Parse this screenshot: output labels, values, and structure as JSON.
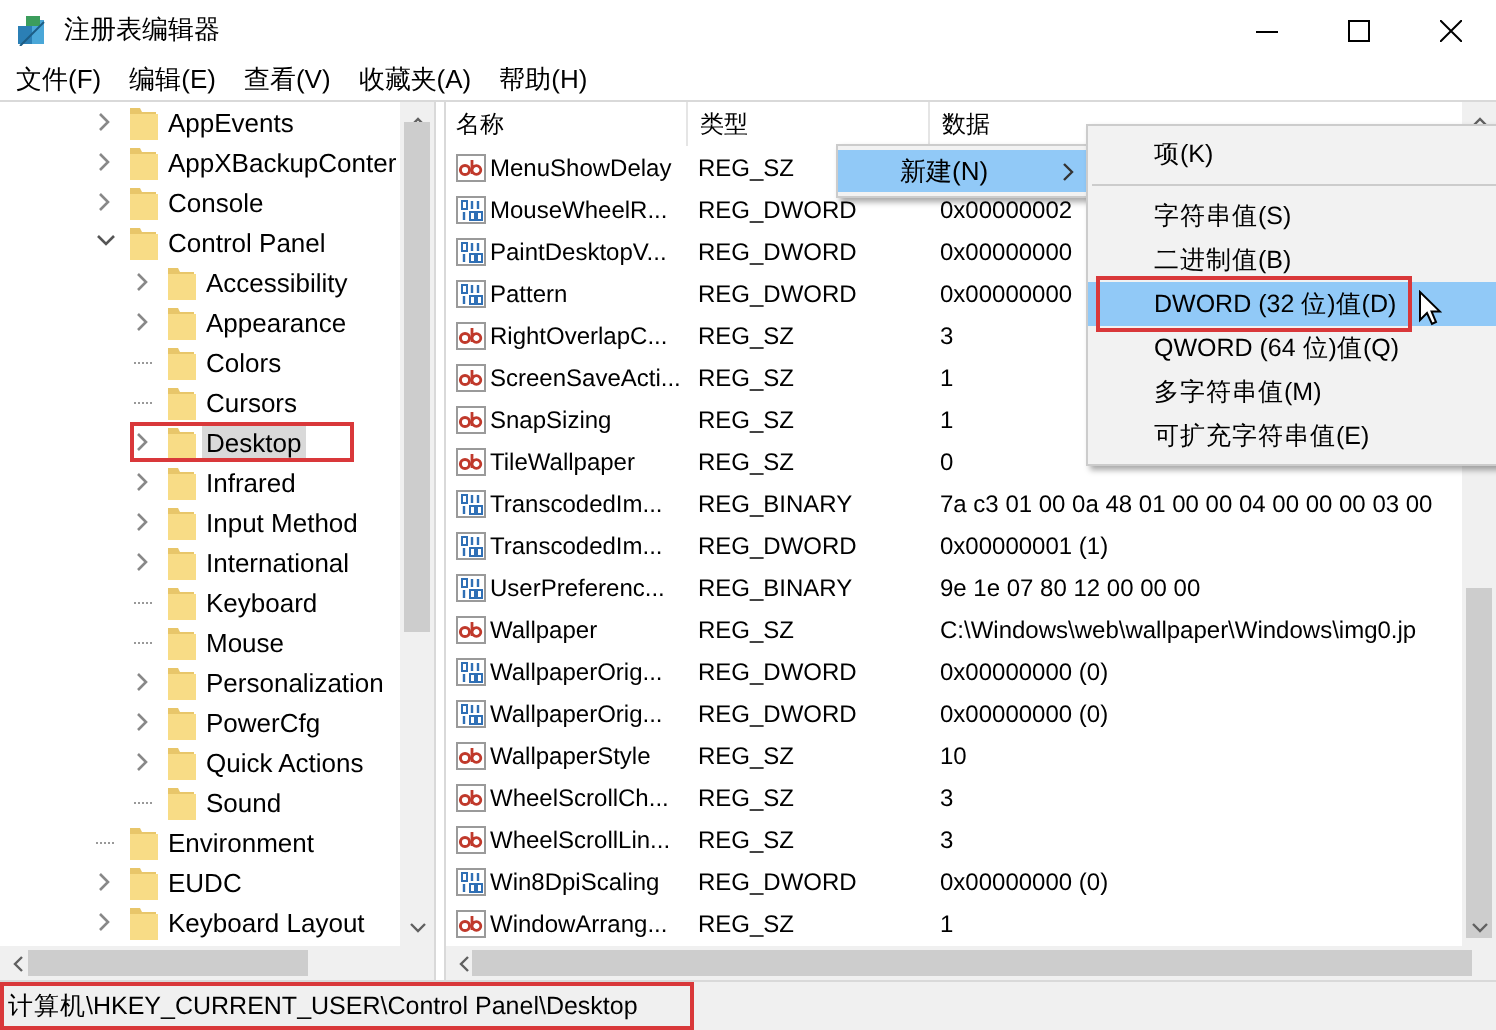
{
  "window": {
    "title": "注册表编辑器"
  },
  "menu_bar": [
    "文件(F)",
    "编辑(E)",
    "查看(V)",
    "收藏夹(A)",
    "帮助(H)"
  ],
  "tree": [
    {
      "kind": "node",
      "label": "AppEvents",
      "expanded": false,
      "selected": false,
      "highlighted": false
    },
    {
      "kind": "node",
      "label": "AppXBackupConter",
      "expanded": false,
      "selected": false,
      "highlighted": false
    },
    {
      "kind": "node",
      "label": "Console",
      "expanded": false,
      "selected": false,
      "highlighted": false
    },
    {
      "kind": "node",
      "label": "Control Panel",
      "expanded": true,
      "selected": false,
      "highlighted": false,
      "children": [
        {
          "kind": "node",
          "label": "Accessibility",
          "expanded": false,
          "selected": false,
          "highlighted": false
        },
        {
          "kind": "node",
          "label": "Appearance",
          "expanded": false,
          "selected": false,
          "highlighted": false
        },
        {
          "kind": "leaf",
          "label": "Colors",
          "selected": false,
          "highlighted": false
        },
        {
          "kind": "leaf",
          "label": "Cursors",
          "selected": false,
          "highlighted": false
        },
        {
          "kind": "node",
          "label": "Desktop",
          "expanded": false,
          "selected": true,
          "highlighted": true
        },
        {
          "kind": "node",
          "label": "Infrared",
          "expanded": false,
          "selected": false,
          "highlighted": false
        },
        {
          "kind": "node",
          "label": "Input Method",
          "expanded": false,
          "selected": false,
          "highlighted": false
        },
        {
          "kind": "node",
          "label": "International",
          "expanded": false,
          "selected": false,
          "highlighted": false
        },
        {
          "kind": "leaf",
          "label": "Keyboard",
          "selected": false,
          "highlighted": false
        },
        {
          "kind": "leaf",
          "label": "Mouse",
          "selected": false,
          "highlighted": false
        },
        {
          "kind": "node",
          "label": "Personalization",
          "expanded": false,
          "selected": false,
          "highlighted": false
        },
        {
          "kind": "node",
          "label": "PowerCfg",
          "expanded": false,
          "selected": false,
          "highlighted": false
        },
        {
          "kind": "node",
          "label": "Quick Actions",
          "expanded": false,
          "selected": false,
          "highlighted": false
        },
        {
          "kind": "leaf",
          "label": "Sound",
          "selected": false,
          "highlighted": false
        }
      ]
    },
    {
      "kind": "leaf",
      "label": "Environment",
      "selected": false,
      "highlighted": false
    },
    {
      "kind": "node",
      "label": "EUDC",
      "expanded": false,
      "selected": false,
      "highlighted": false
    },
    {
      "kind": "node",
      "label": "Keyboard Layout",
      "expanded": false,
      "selected": false,
      "highlighted": false
    }
  ],
  "list": {
    "columns": [
      "名称",
      "类型",
      "数据"
    ],
    "rows": [
      {
        "kind": "string",
        "name": "MenuShowDelay",
        "type": "REG_SZ"
      },
      {
        "kind": "binary",
        "name": "MouseWheelR...",
        "type": "REG_DWORD",
        "data": "0x00000002"
      },
      {
        "kind": "binary",
        "name": "PaintDesktopV...",
        "type": "REG_DWORD",
        "data": "0x00000000"
      },
      {
        "kind": "binary",
        "name": "Pattern",
        "type": "REG_DWORD",
        "data": "0x00000000"
      },
      {
        "kind": "string",
        "name": "RightOverlapC...",
        "type": "REG_SZ",
        "data": "3"
      },
      {
        "kind": "string",
        "name": "ScreenSaveActi...",
        "type": "REG_SZ",
        "data": "1"
      },
      {
        "kind": "string",
        "name": "SnapSizing",
        "type": "REG_SZ",
        "data": "1"
      },
      {
        "kind": "string",
        "name": "TileWallpaper",
        "type": "REG_SZ",
        "data": "0"
      },
      {
        "kind": "binary",
        "name": "TranscodedIm...",
        "type": "REG_BINARY",
        "data": "7a c3 01 00 0a 48 01 00 00 04 00 00 00 03 00"
      },
      {
        "kind": "binary",
        "name": "TranscodedIm...",
        "type": "REG_DWORD",
        "data": "0x00000001 (1)"
      },
      {
        "kind": "binary",
        "name": "UserPreferenc...",
        "type": "REG_BINARY",
        "data": "9e 1e 07 80 12 00 00 00"
      },
      {
        "kind": "string",
        "name": "Wallpaper",
        "type": "REG_SZ",
        "data": "C:\\Windows\\web\\wallpaper\\Windows\\img0.jp"
      },
      {
        "kind": "binary",
        "name": "WallpaperOrig...",
        "type": "REG_DWORD",
        "data": "0x00000000 (0)"
      },
      {
        "kind": "binary",
        "name": "WallpaperOrig...",
        "type": "REG_DWORD",
        "data": "0x00000000 (0)"
      },
      {
        "kind": "string",
        "name": "WallpaperStyle",
        "type": "REG_SZ",
        "data": "10"
      },
      {
        "kind": "string",
        "name": "WheelScrollCh...",
        "type": "REG_SZ",
        "data": "3"
      },
      {
        "kind": "string",
        "name": "WheelScrollLin...",
        "type": "REG_SZ",
        "data": "3"
      },
      {
        "kind": "binary",
        "name": "Win8DpiScaling",
        "type": "REG_DWORD",
        "data": "0x00000000 (0)"
      },
      {
        "kind": "string",
        "name": "WindowArrang...",
        "type": "REG_SZ",
        "data": "1"
      }
    ]
  },
  "context_menu": {
    "items": [
      {
        "label": "新建(N)",
        "selected": true,
        "has_submenu": true
      }
    ]
  },
  "submenu": {
    "items": [
      {
        "kind": "item",
        "label": "项(K)",
        "selected": false,
        "highlighted": false
      },
      {
        "kind": "separator"
      },
      {
        "kind": "item",
        "label": "字符串值(S)",
        "selected": false,
        "highlighted": false
      },
      {
        "kind": "item",
        "label": "二进制值(B)",
        "selected": false,
        "highlighted": false
      },
      {
        "kind": "item",
        "label": "DWORD (32 位)值(D)",
        "selected": true,
        "highlighted": true
      },
      {
        "kind": "item",
        "label": "QWORD (64 位)值(Q)",
        "selected": false,
        "highlighted": false
      },
      {
        "kind": "item",
        "label": "多字符串值(M)",
        "selected": false,
        "highlighted": false
      },
      {
        "kind": "item",
        "label": "可扩充字符串值(E)",
        "selected": false,
        "highlighted": false
      }
    ]
  },
  "status_bar": {
    "path": "计算机\\HKEY_CURRENT_USER\\Control Panel\\Desktop",
    "highlighted": true
  }
}
